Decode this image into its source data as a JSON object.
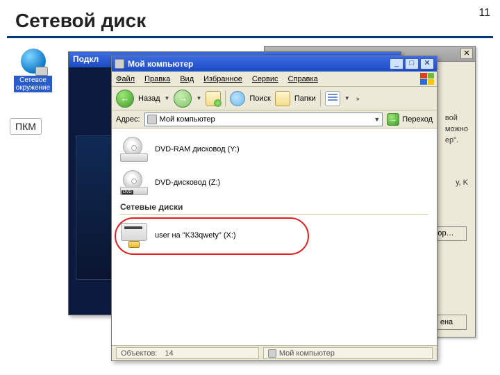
{
  "slide": {
    "title": "Сетевой диск",
    "number": "11"
  },
  "desktop_icon": {
    "label": "Сетевое окружение"
  },
  "pkm_label": "ПКМ",
  "back_dialog": {
    "text_line1": "вой",
    "text_line2": "можно",
    "text_line3": "ер\".",
    "drive_letter": "у, K",
    "browse": "ор…",
    "cancel": "ена"
  },
  "mid_window": {
    "title": "Подкл"
  },
  "explorer": {
    "title": "Мой компьютер",
    "menubar": {
      "file": "Файл",
      "edit": "Правка",
      "view": "Вид",
      "favorites": "Избранное",
      "tools": "Сервис",
      "help": "Справка"
    },
    "toolbar": {
      "back": "Назад",
      "search": "Поиск",
      "folders": "Папки",
      "chevrons": "»"
    },
    "addressbar": {
      "label": "Адрес:",
      "value": "Мой компьютер",
      "go": "Переход"
    },
    "items": {
      "dvd_ram": "DVD-RAM дисковод (Y:)",
      "dvd": "DVD-дисковод (Z:)",
      "dvd_badge": "DVD"
    },
    "group_net": "Сетевые диски",
    "net_drive": "user на \"K33qwety\" (X:)",
    "statusbar": {
      "objects_label": "Объектов:",
      "objects_count": "14",
      "location": "Мой компьютер"
    }
  }
}
